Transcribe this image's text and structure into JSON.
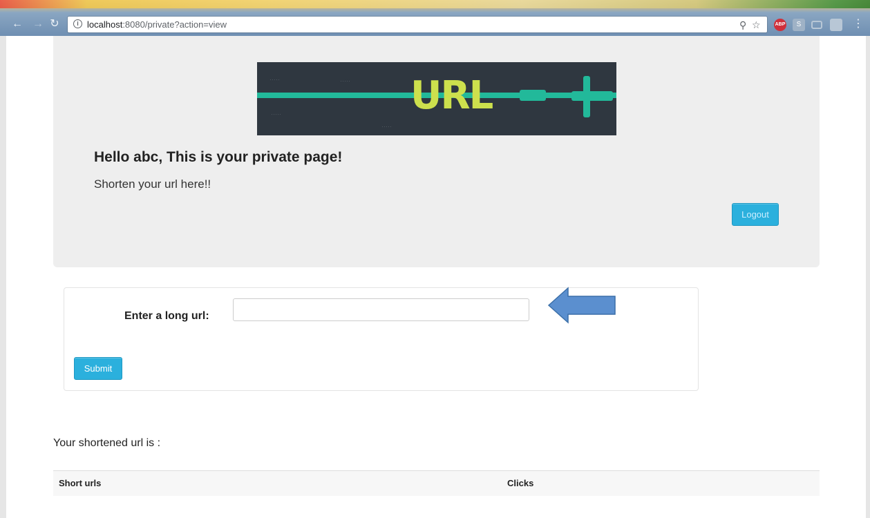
{
  "browser": {
    "url_host": "localhost",
    "url_rest": ":8080/private?action=view",
    "back_icon": "back-arrow-icon",
    "forward_icon": "forward-arrow-icon",
    "reload_icon": "reload-icon",
    "info_icon": "info-icon",
    "key_icon": "key-icon",
    "star_icon": "star-icon",
    "extensions": [
      "adblock-plus-icon",
      "skype-icon",
      "cast-icon",
      "extension-icon"
    ],
    "menu_icon": "menu-dots-icon",
    "abp_label": "ABP",
    "s_label": "S"
  },
  "header": {
    "banner_word": "URL",
    "greeting": "Hello abc, This is your private page!",
    "subtitle": "Shorten your url here!!",
    "logout_label": "Logout"
  },
  "form": {
    "label": "Enter a long url:",
    "input_value": "",
    "input_placeholder": "",
    "submit_label": "Submit"
  },
  "results": {
    "title": "Your shortened url is :",
    "columns": [
      "Short urls",
      "Clicks"
    ]
  },
  "colors": {
    "button": "#2bb0dd",
    "jumbotron": "#eeeeee",
    "arrow": "#5b8fcf",
    "banner_accent": "#22b99a",
    "banner_word": "#cde04d"
  }
}
